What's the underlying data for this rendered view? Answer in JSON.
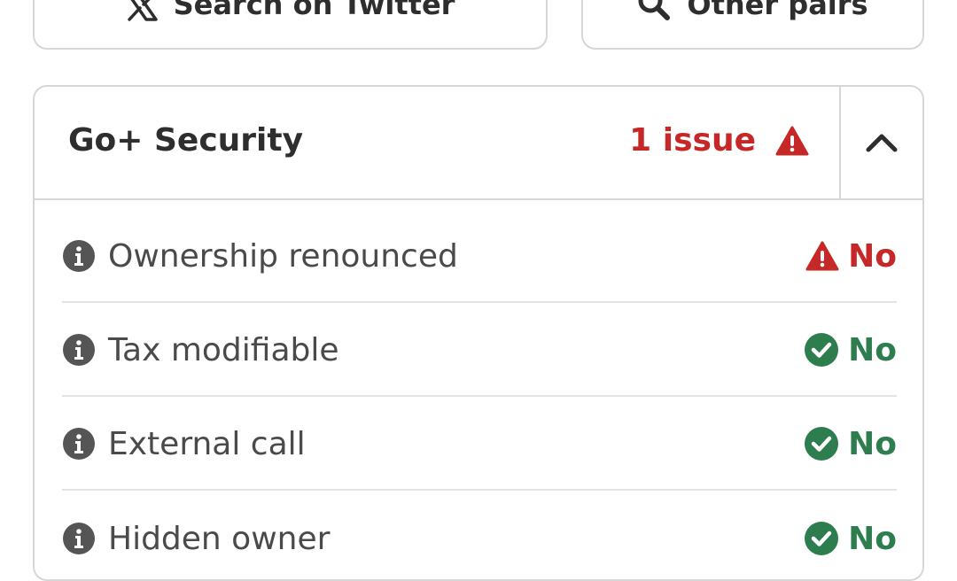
{
  "buttons": {
    "twitter": {
      "label": "Search on Twitter",
      "icon": "x-logo-icon"
    },
    "pairs": {
      "label": "Other pairs",
      "icon": "search-icon"
    }
  },
  "security": {
    "title": "Go+ Security",
    "issue_text": "1 issue",
    "issue_icon": "warning-icon",
    "toggle_icon": "chevron-up-icon",
    "rows": [
      {
        "label": "Ownership renounced",
        "value": "No",
        "status": "warning",
        "info_icon": "info-icon"
      },
      {
        "label": "Tax modifiable",
        "value": "No",
        "status": "ok",
        "info_icon": "info-icon"
      },
      {
        "label": "External call",
        "value": "No",
        "status": "ok",
        "info_icon": "info-icon"
      },
      {
        "label": "Hidden owner",
        "value": "No",
        "status": "ok",
        "info_icon": "info-icon"
      }
    ]
  },
  "colors": {
    "danger": "#c62828",
    "success": "#2e7d4f",
    "border": "#d6d6d6",
    "text": "#2e2e2e"
  }
}
